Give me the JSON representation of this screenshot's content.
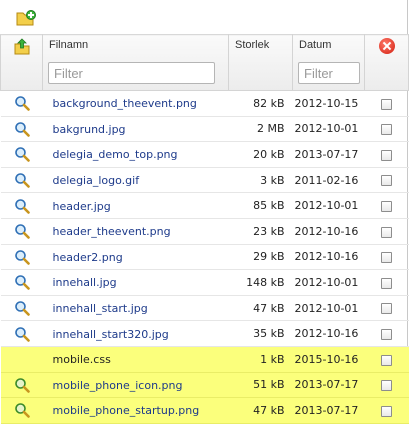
{
  "colors": {
    "highlight": "#fbff7c",
    "link": "#1d3a8a",
    "delete": "#d21e10"
  },
  "toolbar": {
    "add_folder_icon": "folder-add-icon"
  },
  "header": {
    "up_icon": "folder-up-icon",
    "name_label": "Filnamn",
    "name_filter_placeholder": "Filter",
    "size_label": "Storlek",
    "date_label": "Datum",
    "date_filter_placeholder": "Filter",
    "delete_icon": "delete-icon"
  },
  "files": [
    {
      "name": "background_theevent.png",
      "size": "82 kB",
      "date": "2012-10-15",
      "preview": true,
      "highlighted": false
    },
    {
      "name": "bakgrund.jpg",
      "size": "2 MB",
      "date": "2012-10-01",
      "preview": true,
      "highlighted": false
    },
    {
      "name": "delegia_demo_top.png",
      "size": "20 kB",
      "date": "2013-07-17",
      "preview": true,
      "highlighted": false
    },
    {
      "name": "delegia_logo.gif",
      "size": "3 kB",
      "date": "2011-02-16",
      "preview": true,
      "highlighted": false
    },
    {
      "name": "header.jpg",
      "size": "85 kB",
      "date": "2012-10-01",
      "preview": true,
      "highlighted": false
    },
    {
      "name": "header_theevent.png",
      "size": "23 kB",
      "date": "2012-10-16",
      "preview": true,
      "highlighted": false
    },
    {
      "name": "header2.png",
      "size": "29 kB",
      "date": "2012-10-16",
      "preview": true,
      "highlighted": false
    },
    {
      "name": "innehall.jpg",
      "size": "148 kB",
      "date": "2012-10-01",
      "preview": true,
      "highlighted": false
    },
    {
      "name": "innehall_start.jpg",
      "size": "47 kB",
      "date": "2012-10-01",
      "preview": true,
      "highlighted": false
    },
    {
      "name": "innehall_start320.jpg",
      "size": "35 kB",
      "date": "2012-10-16",
      "preview": true,
      "highlighted": false
    },
    {
      "name": "mobile.css",
      "size": "1 kB",
      "date": "2015-10-16",
      "preview": false,
      "highlighted": true
    },
    {
      "name": "mobile_phone_icon.png",
      "size": "51 kB",
      "date": "2013-07-17",
      "preview": true,
      "highlighted": true
    },
    {
      "name": "mobile_phone_startup.png",
      "size": "47 kB",
      "date": "2013-07-17",
      "preview": true,
      "highlighted": true
    }
  ]
}
